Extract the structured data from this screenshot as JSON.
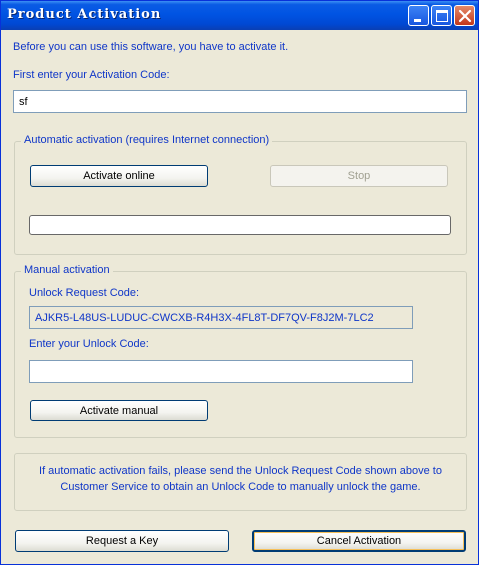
{
  "window": {
    "title": "Product Activation",
    "controls": {
      "minimize_icon": "minimize-icon",
      "maximize_icon": "maximize-icon",
      "close_icon": "close-icon"
    }
  },
  "intro_text": "Before you can use this software, you have to activate it.",
  "activation_code": {
    "label": "First enter your Activation Code:",
    "value": "sf"
  },
  "automatic": {
    "group_label": "Automatic activation (requires Internet connection)",
    "activate_online_label": "Activate online",
    "stop_label": "Stop",
    "progress": 0
  },
  "manual": {
    "group_label": "Manual activation",
    "unlock_request_label": "Unlock Request Code:",
    "unlock_request_value": "AJKR5-L48US-LUDUC-CWCXB-R4H3X-4FL8T-DF7QV-F8J2M-7LC2",
    "unlock_code_label": "Enter your Unlock Code:",
    "unlock_code_value": "",
    "activate_manual_label": "Activate manual"
  },
  "info": {
    "line1": "If automatic activation fails, please send the Unlock Request Code shown above to",
    "line2": "Customer Service to obtain an Unlock Code to manually unlock the game."
  },
  "footer": {
    "request_key_label": "Request a Key",
    "cancel_label": "Cancel Activation"
  },
  "colors": {
    "titlebar": "#0054e3",
    "label_text": "#0f36c8",
    "window_bg": "#ece9d8"
  }
}
